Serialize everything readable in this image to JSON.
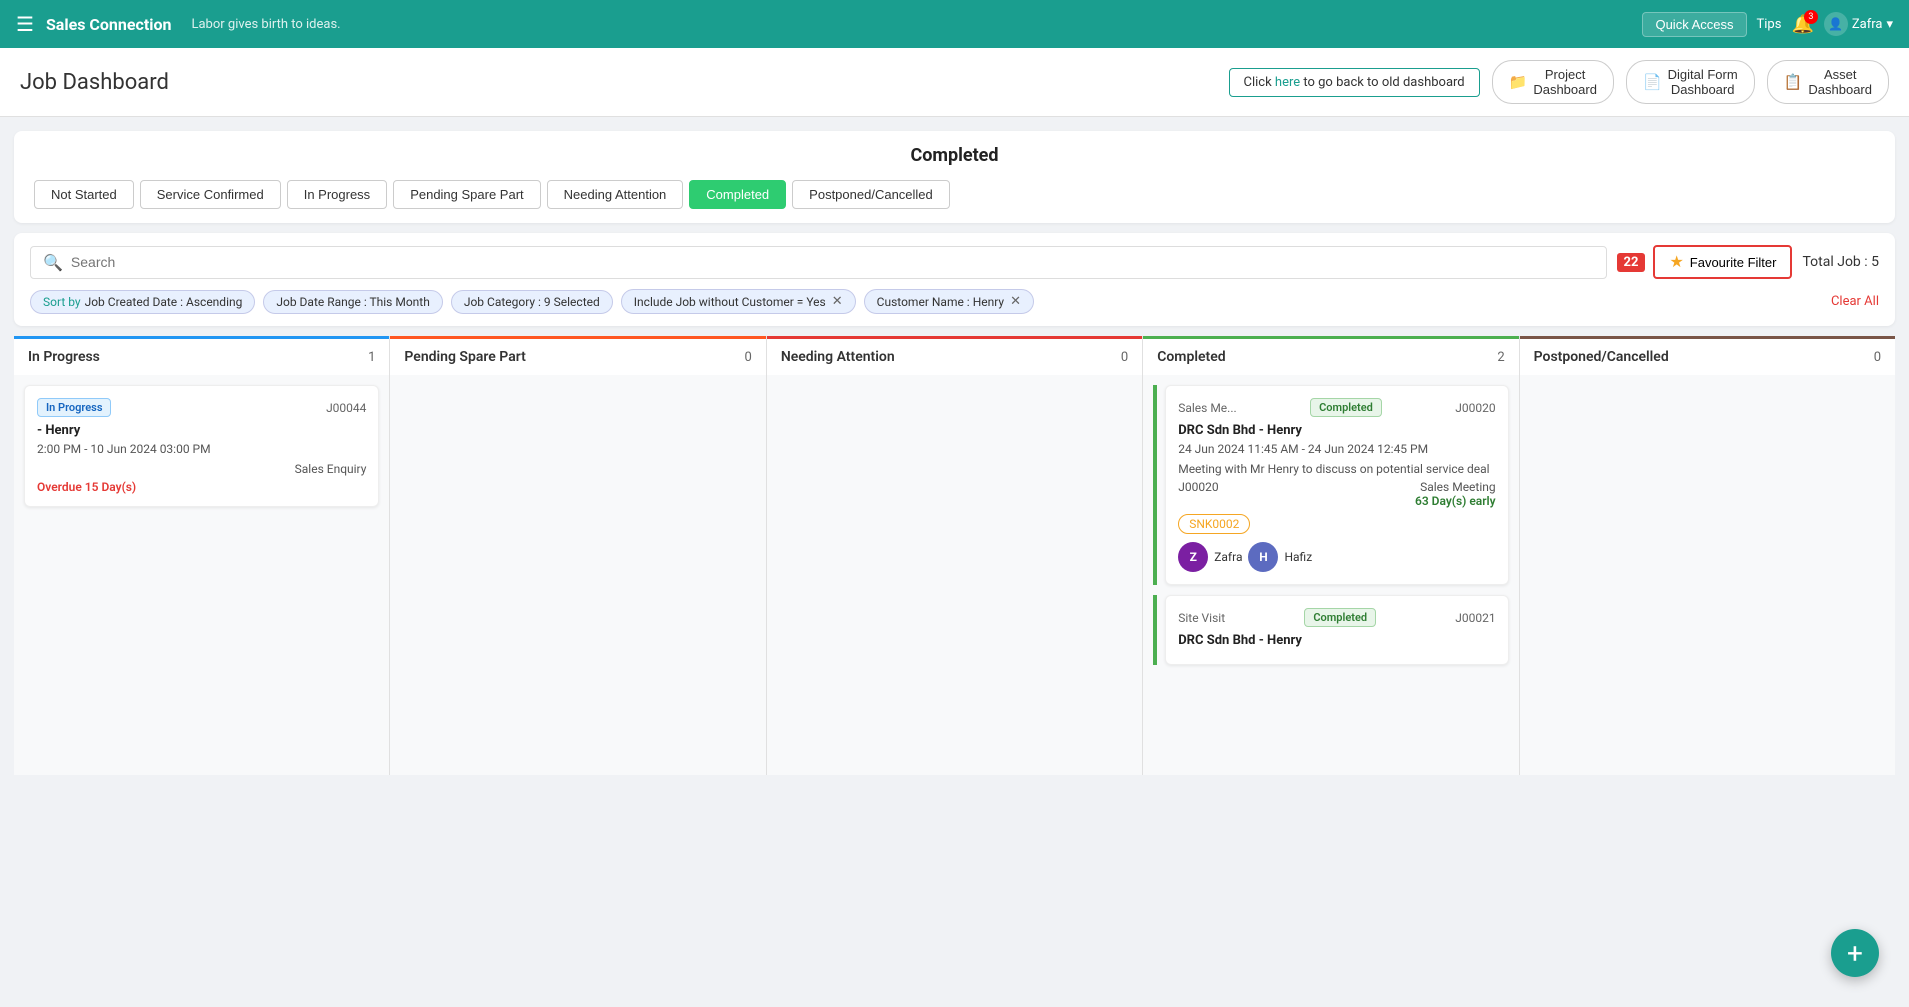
{
  "topnav": {
    "brand": "Sales Connection",
    "tagline": "Labor gives birth to ideas.",
    "quick_access": "Quick Access",
    "tips": "Tips",
    "user": "Zafra"
  },
  "page": {
    "title": "Job Dashboard",
    "back_text": "Click ",
    "back_link_text": "here",
    "back_suffix": " to go back to old dashboard"
  },
  "dashboards": [
    {
      "icon": "📁",
      "label": "Project Dashboard"
    },
    {
      "icon": "📄",
      "label": "Digital Form Dashboard"
    },
    {
      "icon": "📋",
      "label": "Asset Dashboard"
    }
  ],
  "status_section": {
    "title": "Completed",
    "tabs": [
      {
        "label": "Not Started",
        "active": false
      },
      {
        "label": "Service Confirmed",
        "active": false
      },
      {
        "label": "In Progress",
        "active": false
      },
      {
        "label": "Pending Spare Part",
        "active": false
      },
      {
        "label": "Needing Attention",
        "active": false
      },
      {
        "label": "Completed",
        "active": true
      },
      {
        "label": "Postponed/Cancelled",
        "active": false
      }
    ]
  },
  "filter_bar": {
    "search_placeholder": "Search",
    "fav_count": "22",
    "fav_label": "Favourite Filter",
    "total_label": "Total Job : 5",
    "clear_all": "Clear All",
    "tags": [
      {
        "prefix": "Sort by ",
        "prefix_colored": true,
        "text": "Job Created Date : Ascending",
        "removable": false
      },
      {
        "text": "Job Date Range : This Month",
        "removable": false
      },
      {
        "text": "Job Category : 9 Selected",
        "removable": false
      },
      {
        "text": "Include Job without Customer = Yes",
        "removable": true
      },
      {
        "text": "Customer Name : Henry",
        "removable": true
      }
    ]
  },
  "kanban": {
    "columns": [
      {
        "id": "inprogress",
        "title": "In Progress",
        "count": 1,
        "color": "#2196F3",
        "cards": [
          {
            "status_label": "In Progress",
            "status_type": "inprogress",
            "job_number": "J00044",
            "client": "- Henry",
            "time": "2:00 PM - 10 Jun 2024 03:00 PM",
            "category": "Sales Enquiry",
            "overdue": "Overdue 15 Day(s)"
          }
        ]
      },
      {
        "id": "pending",
        "title": "Pending Spare Part",
        "count": 0,
        "color": "#FF5722",
        "cards": []
      },
      {
        "id": "needing",
        "title": "Needing Attention",
        "count": 0,
        "color": "#e53935",
        "cards": []
      },
      {
        "id": "completed",
        "title": "Completed",
        "count": 2,
        "color": "#4CAF50",
        "cards": [
          {
            "status_label": "Completed",
            "status_type": "completed",
            "category_label": "Sales Me...",
            "job_number": "J00020",
            "client": "DRC Sdn Bhd - Henry",
            "time": "24 Jun 2024 11:45 AM - 24 Jun 2024 12:45 PM",
            "description": "Meeting with Mr Henry to discuss on potential service deal",
            "job_id": "J00020",
            "job_category": "Sales Meeting",
            "early": "63 Day(s) early",
            "snk": "SNK0002",
            "avatars": [
              {
                "initial": "Z",
                "name": "Zafra",
                "color": "#7b1fa2"
              },
              {
                "initial": "H",
                "name": "Hafiz",
                "color": "#5c6bc0"
              }
            ]
          },
          {
            "status_label": "Completed",
            "status_type": "completed",
            "category_label": "Site Visit",
            "job_number": "J00021",
            "client": "DRC Sdn Bhd - Henry",
            "time": "",
            "description": "",
            "job_id": "",
            "job_category": "",
            "early": "",
            "snk": "",
            "avatars": []
          }
        ]
      },
      {
        "id": "postponed",
        "title": "Postponed/Cancelled",
        "count": 0,
        "color": "#795548",
        "cards": []
      }
    ]
  },
  "fab": "+"
}
